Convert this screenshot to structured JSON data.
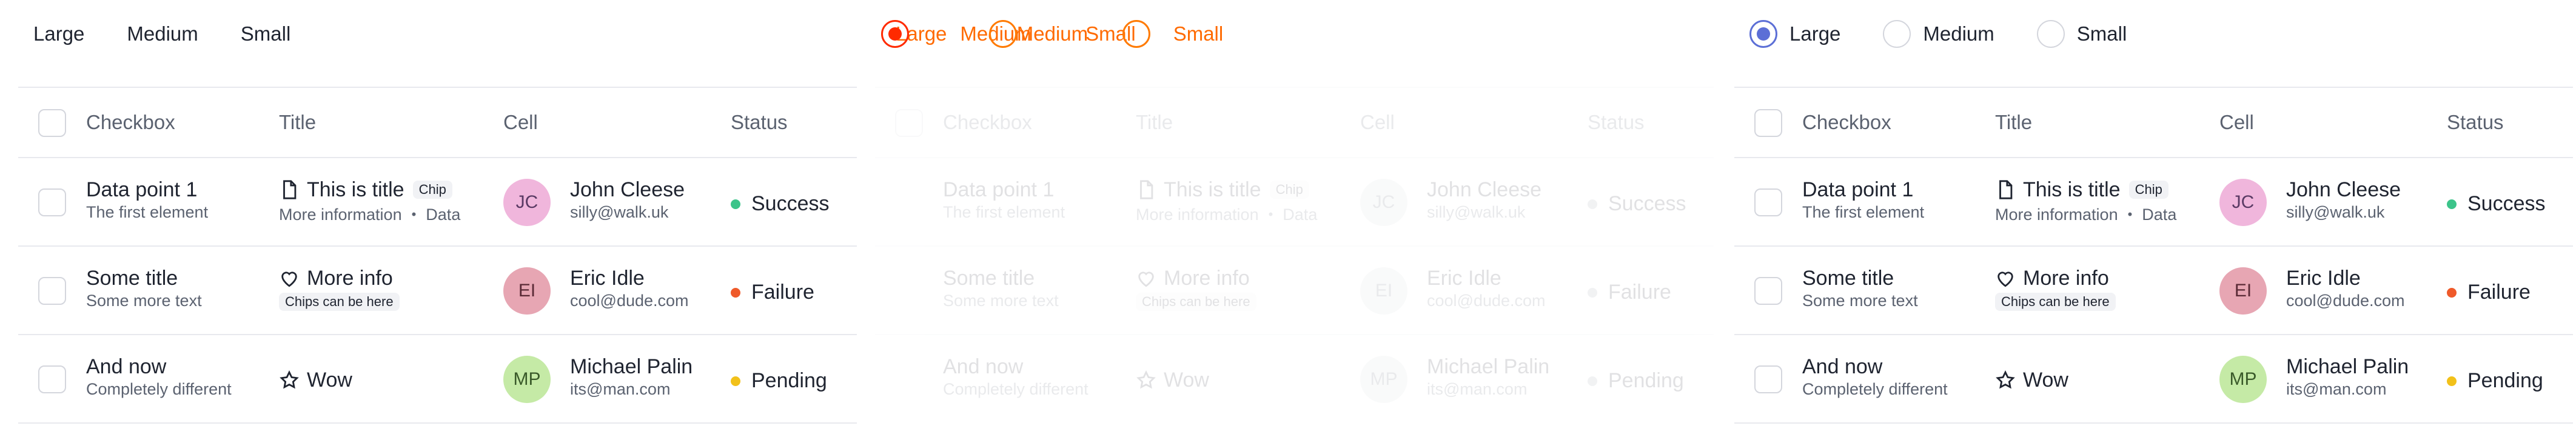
{
  "radio": {
    "options": [
      "Large",
      "Medium",
      "Small"
    ]
  },
  "table": {
    "headers": {
      "checkbox": "Checkbox",
      "title": "Title",
      "cell": "Cell",
      "status": "Status"
    },
    "rows": [
      {
        "primary": "Data point 1",
        "secondary": "The first element",
        "title": "This is title",
        "title_icon": "document-icon",
        "chip": "Chip",
        "info": "More information",
        "info_extra": "Data",
        "avatar_initials": "JC",
        "avatar_color": "#f0b6dc",
        "name": "John Cleese",
        "email": "silly@walk.uk",
        "status": "Success",
        "status_color": "#3cc48a"
      },
      {
        "primary": "Some title",
        "secondary": "Some more text",
        "title": "More info",
        "title_icon": "heart-icon",
        "chip": "Chips can be here",
        "avatar_initials": "EI",
        "avatar_color": "#e7a6b3",
        "name": "Eric Idle",
        "email": "cool@dude.com",
        "status": "Failure",
        "status_color": "#ef5a2a"
      },
      {
        "primary": "And now",
        "secondary": "Completely different",
        "title": "Wow",
        "title_icon": "star-icon",
        "avatar_initials": "MP",
        "avatar_color": "#c5eaa6",
        "name": "Michael Palin",
        "email": "its@man.com",
        "status": "Pending",
        "status_color": "#f2c11a"
      }
    ]
  }
}
